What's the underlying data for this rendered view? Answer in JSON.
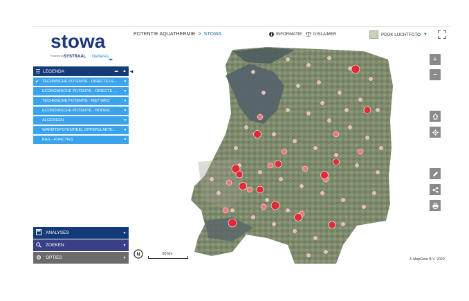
{
  "logo": {
    "name": "stowa",
    "powered_by": "Powered by",
    "partner1": "SYSTRAAL",
    "partner2": "Deltares"
  },
  "breadcrumb": {
    "item1": "POTENTIE AQUATHERMIE",
    "separator": ">",
    "item2": "STOWA"
  },
  "header_links": {
    "info": "INFORMATIE",
    "disclaimer": "DISLAIMER"
  },
  "basemap": {
    "label": "PDOK LUCHTFOTO"
  },
  "legend": {
    "title": "LEGENDA",
    "layers": [
      {
        "label": "TECHNISCHE POTENTIE - DIRECTE LE...",
        "checked": true
      },
      {
        "label": "ECONOMISCHE POTENTIE - DIRECTE ...",
        "checked": false
      },
      {
        "label": "TECHNISCHE POTENTIE - MET WKO",
        "checked": false
      },
      {
        "label": "ECONOMISCHE POTENTIE - BODEM...",
        "checked": false
      },
      {
        "label": "ALGEMEEN",
        "checked": false
      },
      {
        "label": "WARMTEPOTENTIEEL OPPERVLAKTE...",
        "checked": false
      },
      {
        "label": "BAG - FUNCTIES",
        "checked": false
      }
    ]
  },
  "bottom_panels": [
    {
      "label": "ANALYSES",
      "icon": "calculator-icon",
      "color": "#133b78"
    },
    {
      "label": "ZOEKEN",
      "icon": "search-icon",
      "color": "#3a3f86"
    },
    {
      "label": "OPTIES",
      "icon": "gear-icon",
      "color": "#6b6b6b"
    }
  ],
  "map": {
    "scale_label": "50 km",
    "north_label": "N",
    "attribution": "© MapGear B.V. 2020"
  },
  "colors": {
    "dark_blue": "#133b78",
    "layer_blue": "#3aa3eb",
    "button_grey": "#8a8a8a",
    "point_red": "#e02a35",
    "point_pink": "#f7b6bb"
  }
}
